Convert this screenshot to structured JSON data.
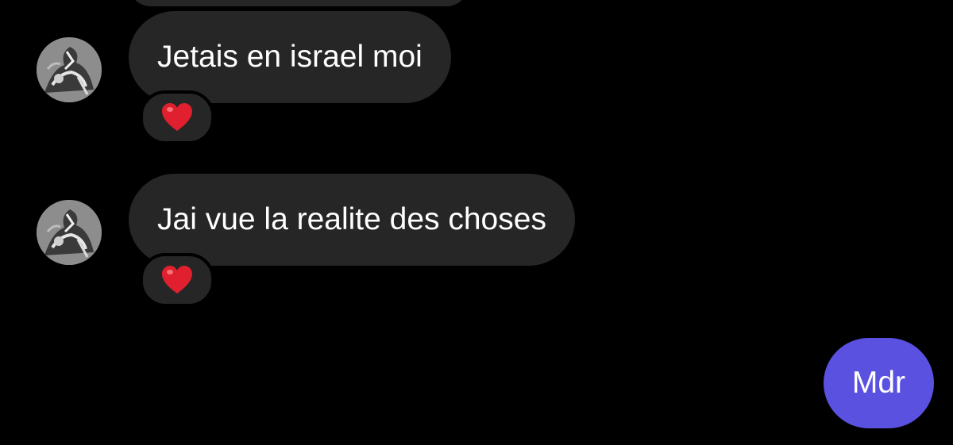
{
  "conversation": {
    "messages": [
      {
        "sender": "other",
        "text": "Jetais en israel moi",
        "reaction": "red-heart"
      },
      {
        "sender": "other",
        "text": "Jai vue la realite des choses",
        "reaction": "red-heart"
      },
      {
        "sender": "me",
        "text": "Mdr"
      }
    ]
  },
  "colors": {
    "background": "#000000",
    "received_bubble": "#262626",
    "sent_bubble": "#5b51e0",
    "text": "#ffffff",
    "heart": "#e0202e"
  }
}
